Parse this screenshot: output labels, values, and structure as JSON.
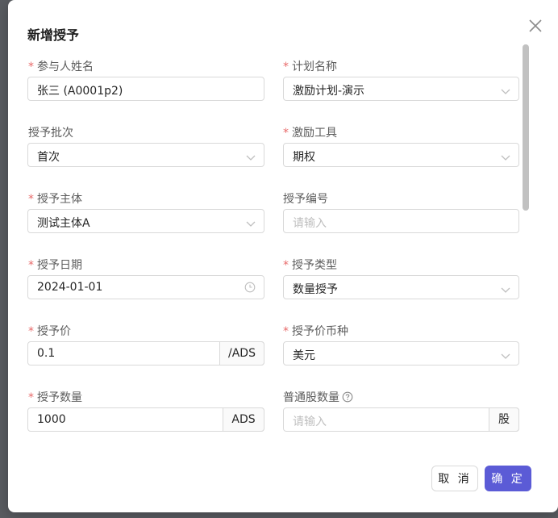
{
  "dialog": {
    "title": "新增授予",
    "buttons": {
      "cancel": "取 消",
      "confirm": "确 定"
    }
  },
  "fields": {
    "participant_name": {
      "label": "参与人姓名",
      "required": true,
      "value": "张三 (A0001p2)"
    },
    "plan_name": {
      "label": "计划名称",
      "required": true,
      "value": "激励计划-演示"
    },
    "grant_batch": {
      "label": "授予批次",
      "required": false,
      "value": "首次"
    },
    "incentive_tool": {
      "label": "激励工具",
      "required": true,
      "value": "期权"
    },
    "grant_entity": {
      "label": "授予主体",
      "required": true,
      "value": "测试主体A"
    },
    "grant_number": {
      "label": "授予编号",
      "required": false,
      "placeholder": "请输入"
    },
    "grant_date": {
      "label": "授予日期",
      "required": true,
      "value": "2024-01-01"
    },
    "grant_type": {
      "label": "授予类型",
      "required": true,
      "value": "数量授予"
    },
    "grant_price": {
      "label": "授予价",
      "required": true,
      "value": "0.1",
      "addon": "/ADS"
    },
    "price_currency": {
      "label": "授予价币种",
      "required": true,
      "value": "美元"
    },
    "grant_quantity": {
      "label": "授予数量",
      "required": true,
      "value": "1000",
      "addon": "ADS"
    },
    "common_shares": {
      "label": "普通股数量",
      "required": false,
      "placeholder": "请输入",
      "addon": "股"
    }
  },
  "icons": {
    "close": "close-icon",
    "dropdown": "chevron-down-icon",
    "date": "clock-icon",
    "help": "question-circle-icon"
  },
  "colors": {
    "primary": "#5b5bd6",
    "required": "#e86a6a"
  }
}
